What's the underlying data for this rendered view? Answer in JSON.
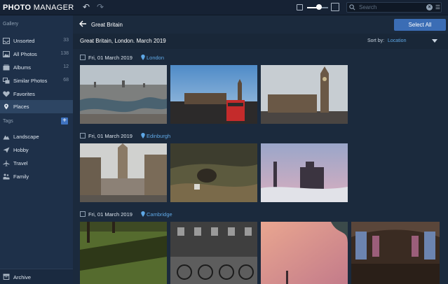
{
  "app": {
    "logo_bold": "PHOTO",
    "logo_rest": " MANAGER"
  },
  "search": {
    "placeholder": "Search"
  },
  "sidebar": {
    "gallery_heading": "Gallery",
    "items": [
      {
        "label": "Unsorted",
        "count": "33",
        "icon": "inbox-icon"
      },
      {
        "label": "All Photos",
        "count": "138",
        "icon": "photos-icon"
      },
      {
        "label": "Albums",
        "count": "12",
        "icon": "album-icon"
      },
      {
        "label": "Similar Photos",
        "count": "68",
        "icon": "similar-icon"
      },
      {
        "label": "Favorites",
        "count": "",
        "icon": "heart-icon"
      },
      {
        "label": "Places",
        "count": "",
        "icon": "pin-icon",
        "active": true
      }
    ],
    "tags_heading": "Tags",
    "tags": [
      {
        "label": "Landscape",
        "icon": "mountain-icon"
      },
      {
        "label": "Hobby",
        "icon": "plane-icon"
      },
      {
        "label": "Travel",
        "icon": "airplane-icon"
      },
      {
        "label": "Family",
        "icon": "family-icon"
      }
    ],
    "archive_label": "Archive"
  },
  "header": {
    "title": "Great Britain",
    "select_all": "Select All"
  },
  "subheader": {
    "title": "Great Britain, London. March 2019",
    "sort_label": "Sort by:",
    "sort_value": "Location"
  },
  "groups": [
    {
      "date": "Fri, 01 March 2019",
      "place": "London"
    },
    {
      "date": "Fri, 01 March 2019",
      "place": "Edinburgh"
    },
    {
      "date": "Fri, 01 March 2019",
      "place": "Cambridge"
    }
  ],
  "zoom": {
    "level": 0.55
  },
  "colors": {
    "accent": "#3b6db5",
    "place_link": "#5fa8e6",
    "sidebar": "#1e3049",
    "active": "#2d4563"
  }
}
